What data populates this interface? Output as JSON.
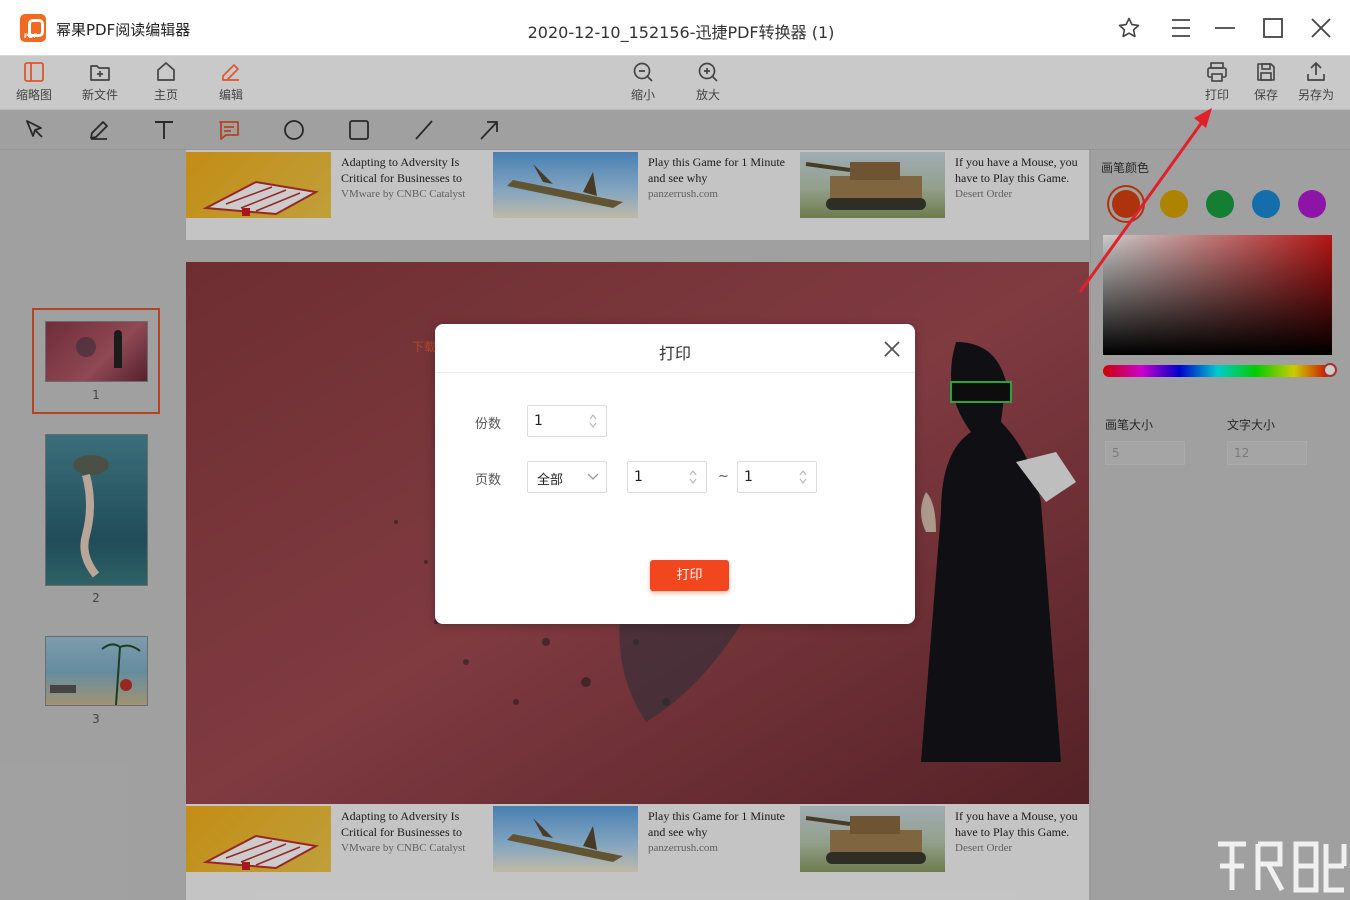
{
  "app": {
    "name": "幂果PDF阅读编辑器",
    "logo_tag": "PDF"
  },
  "window": {
    "title": "2020-12-10_152156-迅捷PDF转换器 (1)"
  },
  "toolbar": {
    "left": [
      {
        "label": "缩略图",
        "icon": "thumbnail-icon"
      },
      {
        "label": "新文件",
        "icon": "new-file-icon"
      },
      {
        "label": "主页",
        "icon": "home-icon"
      },
      {
        "label": "编辑",
        "icon": "edit-icon"
      }
    ],
    "center": [
      {
        "label": "缩小",
        "icon": "zoom-out-icon"
      },
      {
        "label": "放大",
        "icon": "zoom-in-icon"
      }
    ],
    "right": [
      {
        "label": "打印",
        "icon": "print-icon"
      },
      {
        "label": "保存",
        "icon": "save-icon"
      },
      {
        "label": "另存为",
        "icon": "export-icon"
      }
    ]
  },
  "draw_tools": [
    "select-icon",
    "pen-icon",
    "text-icon",
    "comment-icon",
    "circle-icon",
    "rectangle-icon",
    "line-icon",
    "arrow-icon"
  ],
  "thumbnails": [
    {
      "page": "1",
      "selected": true
    },
    {
      "page": "2",
      "selected": false
    },
    {
      "page": "3",
      "selected": false
    }
  ],
  "ads": [
    {
      "title": "Adapting to Adversity Is Critical for Businesses to",
      "source": "VMware by CNBC Catalyst"
    },
    {
      "title": "Play this Game for 1 Minute and see why",
      "source": "panzerrush.com"
    },
    {
      "title": "If you have a Mouse, you have to Play this Game.",
      "source": "Desert Order"
    }
  ],
  "right_panel": {
    "color_label": "画笔颜色",
    "swatches": [
      "#d9400f",
      "#d9a400",
      "#1a9e3f",
      "#1a8ad6",
      "#b21ad1"
    ],
    "pen_size_label": "画笔大小",
    "pen_size_value": "5",
    "text_size_label": "文字大小",
    "text_size_value": "12"
  },
  "print_dialog": {
    "title": "打印",
    "copies_label": "份数",
    "copies_value": "1",
    "pages_label": "页数",
    "range_option": "全部",
    "from_page": "1",
    "range_separator": "~",
    "to_page": "1",
    "print_button": "打印"
  },
  "page_overlay_text": "下载",
  "colors": {
    "accent": "#f2461e",
    "selection": "#e0562a"
  }
}
